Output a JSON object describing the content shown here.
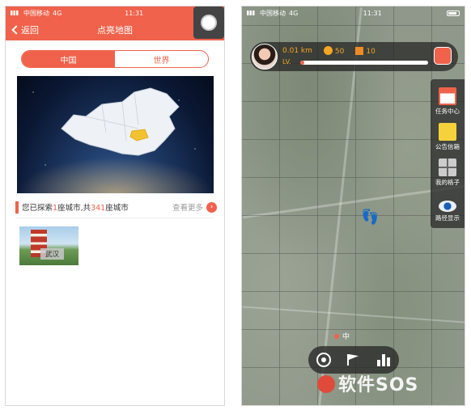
{
  "left": {
    "status": {
      "carrier": "中国移动",
      "network": "4G",
      "time": "11:31"
    },
    "nav": {
      "back_label": "返回",
      "title": "点亮地图"
    },
    "tabs": [
      {
        "label": "中国",
        "active": true
      },
      {
        "label": "世界",
        "active": false
      }
    ],
    "explore": {
      "prefix": "您已探索",
      "explored_count": "1",
      "middle": "座城市,共",
      "total_count": "341",
      "suffix": "座城市",
      "more_label": "查看更多"
    },
    "cities": [
      {
        "name": "武汉"
      }
    ]
  },
  "right": {
    "status": {
      "carrier": "中国移动",
      "network": "4G",
      "time": "11:31"
    },
    "hud": {
      "distance": "0.01",
      "distance_unit": "km",
      "coins": "50",
      "flags": "10",
      "level": "LV.",
      "progress_fraction": 0.02
    },
    "side_menu": [
      {
        "label": "任务中心",
        "icon": "task-icon"
      },
      {
        "label": "公告信箱",
        "icon": "mailbox-icon"
      },
      {
        "label": "我的格子",
        "icon": "grid-icon"
      },
      {
        "label": "路径显示",
        "icon": "eye-icon"
      }
    ],
    "location_label": "中",
    "bottom_buttons": [
      {
        "icon": "locate-icon"
      },
      {
        "icon": "flag-icon"
      },
      {
        "icon": "ranking-icon"
      }
    ]
  },
  "watermark": "软件SOS",
  "colors": {
    "accent": "#f0624b",
    "hud_text": "#f5a623"
  }
}
